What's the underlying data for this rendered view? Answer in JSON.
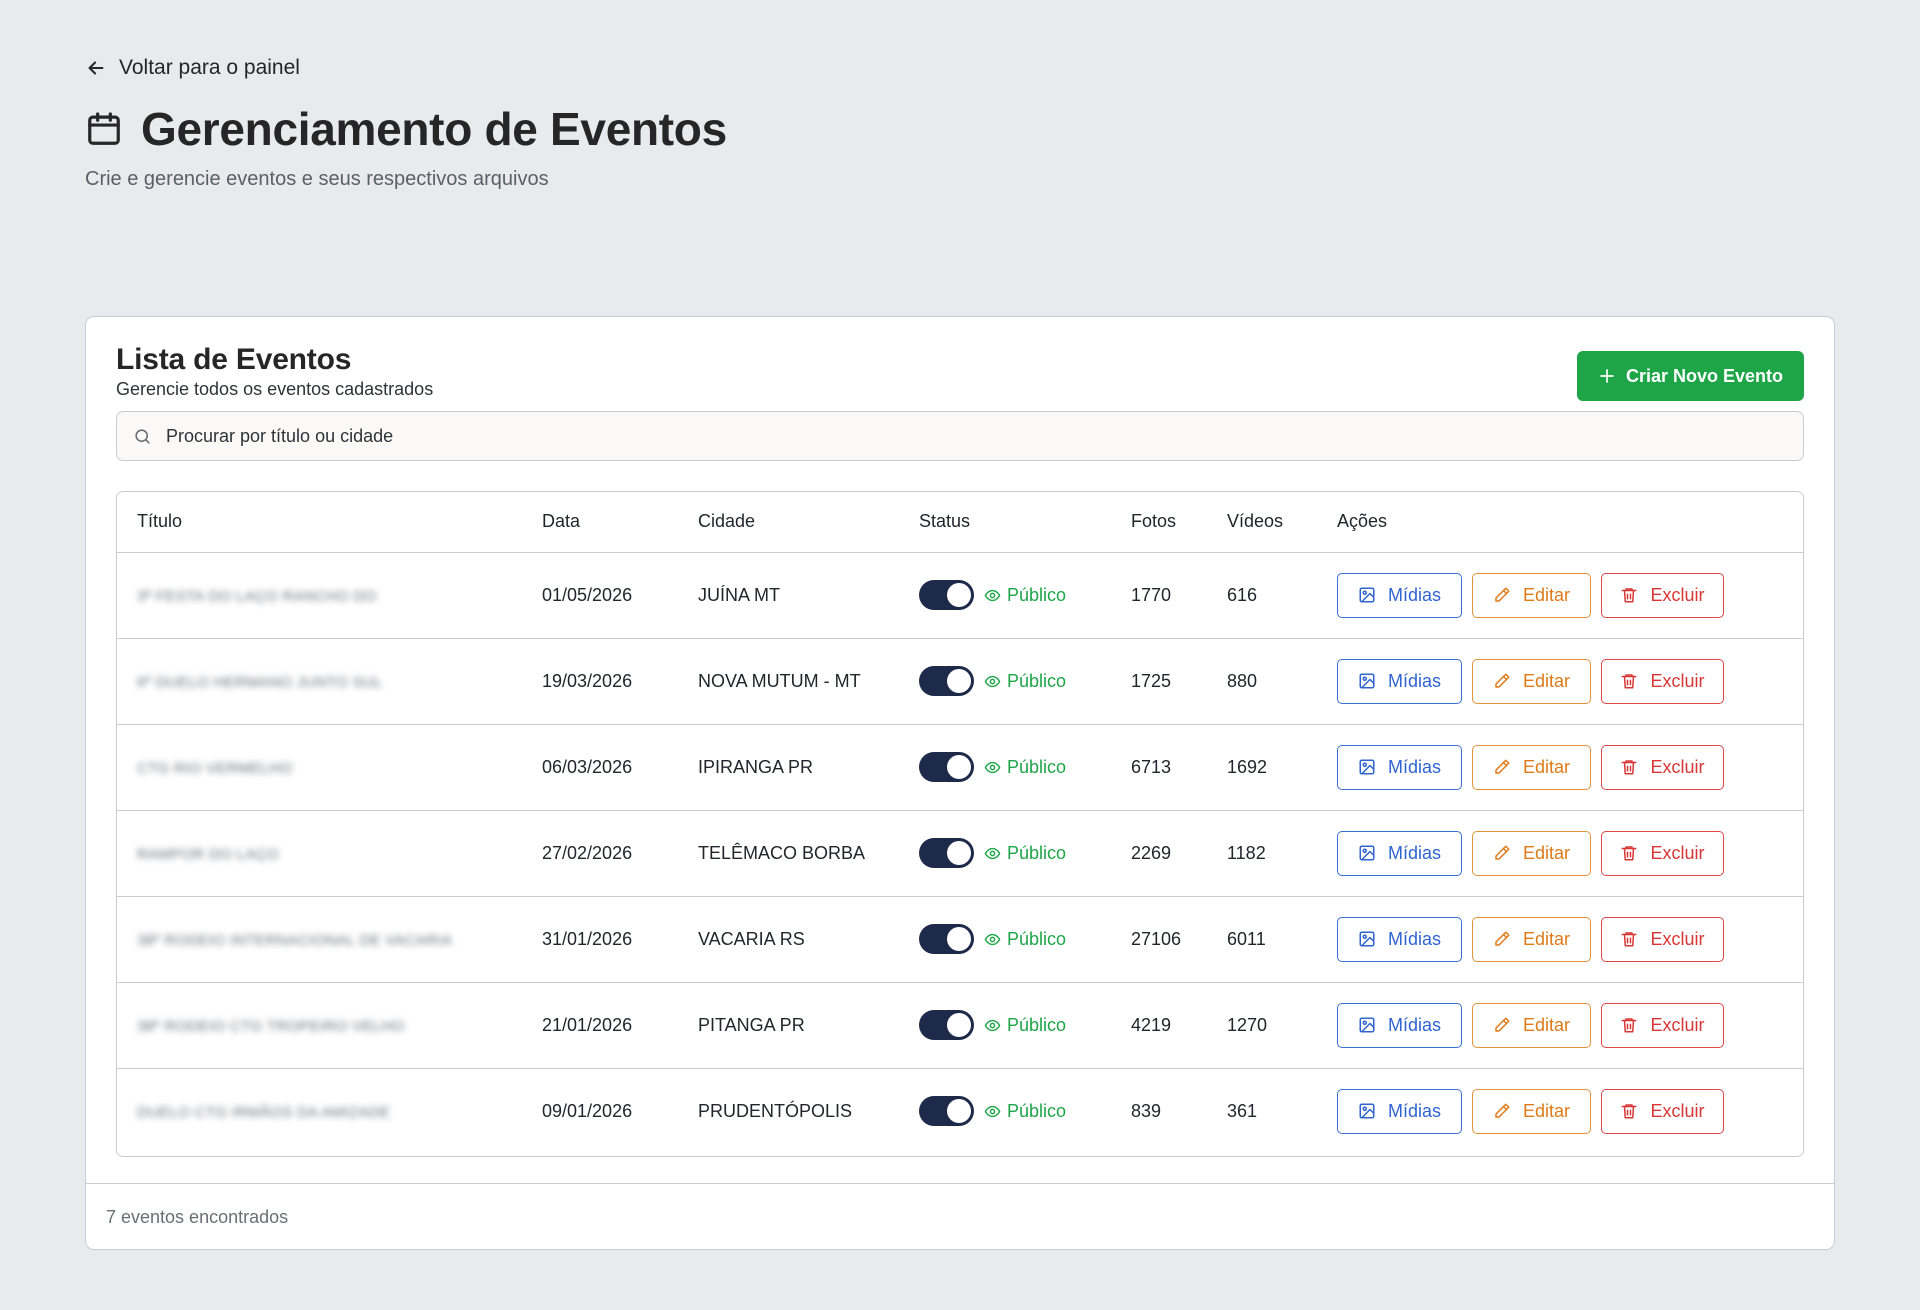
{
  "back": {
    "label": "Voltar para o painel",
    "icon": "arrow-left-icon"
  },
  "page": {
    "title": "Gerenciamento de Eventos",
    "icon": "calendar-icon",
    "subtitle": "Crie e gerencie eventos e seus respectivos arquivos"
  },
  "card": {
    "title": "Lista de Eventos",
    "subtitle": "Gerencie todos os eventos cadastrados",
    "create_label": "Criar Novo Evento",
    "accent": "#1ea548"
  },
  "search": {
    "placeholder": "Procurar por título ou cidade",
    "value": ""
  },
  "table": {
    "headers": {
      "title": "Título",
      "date": "Data",
      "city": "Cidade",
      "status": "Status",
      "fotos": "Fotos",
      "videos": "Vídeos",
      "actions": "Ações"
    },
    "rows": [
      {
        "title": "3ª FESTA DO LAÇO RANCHO DO",
        "date": "01/05/2026",
        "city": "JUÍNA MT",
        "status": "Público",
        "fotos": "1770",
        "videos": "616"
      },
      {
        "title": "6º DUELO HERMANO JUNTO SUL",
        "date": "19/03/2026",
        "city": "NOVA MUTUM - MT",
        "status": "Público",
        "fotos": "1725",
        "videos": "880"
      },
      {
        "title": "CTG RIO VERMELHO",
        "date": "06/03/2026",
        "city": "IPIRANGA PR",
        "status": "Público",
        "fotos": "6713",
        "videos": "1692"
      },
      {
        "title": "RAMPOR DO LAÇO",
        "date": "27/02/2026",
        "city": "TELÊMACO BORBA",
        "status": "Público",
        "fotos": "2269",
        "videos": "1182"
      },
      {
        "title": "38º RODEIO INTERNACIONAL DE VACARIA",
        "date": "31/01/2026",
        "city": "VACARIA RS",
        "status": "Público",
        "fotos": "27106",
        "videos": "6011"
      },
      {
        "title": "38º RODEIO CTG TROPEIRO VELHO",
        "date": "21/01/2026",
        "city": "PITANGA PR",
        "status": "Público",
        "fotos": "4219",
        "videos": "1270"
      },
      {
        "title": "DUELO CTG IRMÃOS DA AMIZADE",
        "date": "09/01/2026",
        "city": "PRUDENTÓPOLIS",
        "status": "Público",
        "fotos": "839",
        "videos": "361"
      }
    ],
    "actions": {
      "midias": "Mídias",
      "editar": "Editar",
      "excluir": "Excluir"
    }
  },
  "footer": {
    "count_text": "7 eventos encontrados"
  },
  "colors": {
    "midias": "#2f64d1",
    "editar": "#de7a17",
    "excluir": "#d93636",
    "public": "#1ea548",
    "toggle": "#1e2a4a"
  }
}
